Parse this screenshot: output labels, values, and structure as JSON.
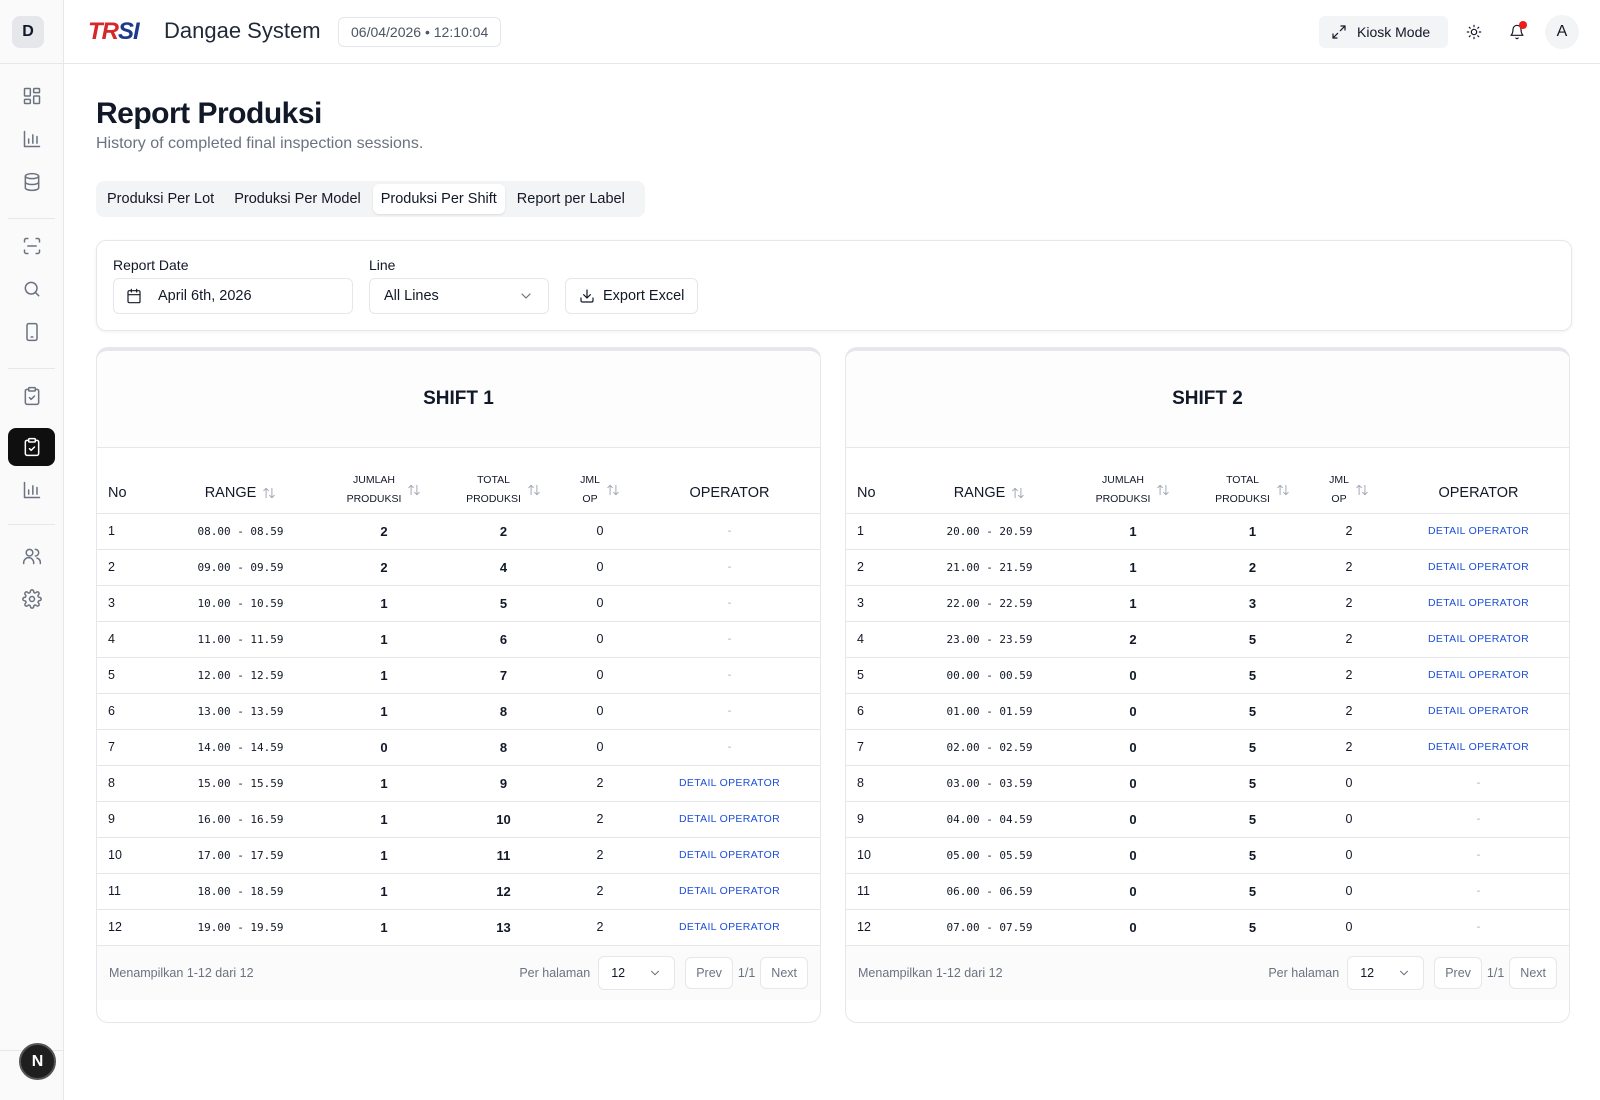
{
  "app": {
    "sidebar_initial": "D",
    "logo_part1": "TR",
    "logo_part2": "SI",
    "title": "Dangae System",
    "datetime": "06/04/2026 • 12:10:04",
    "kiosk_label": "Kiosk Mode",
    "avatar_initial": "A",
    "next_badge": "N",
    "colors": {
      "accent_active": "#0f0f0f",
      "link": "#1d4ed8",
      "notification": "#ef1c1c"
    }
  },
  "sidebar": {
    "icons": [
      "dashboard-icon",
      "bar-chart-icon",
      "database-icon",
      "scan-icon",
      "search-icon",
      "tablet-icon",
      "clipboard-check-icon",
      "clipboard-check-icon",
      "bar-chart-icon",
      "users-icon",
      "settings-icon"
    ]
  },
  "page": {
    "title": "Report Produksi",
    "subtitle": "History of completed final inspection sessions."
  },
  "tabs": [
    {
      "label": "Produksi Per Lot"
    },
    {
      "label": "Produksi Per Model"
    },
    {
      "label": "Produksi Per Shift"
    },
    {
      "label": "Report per Label"
    }
  ],
  "filters": {
    "date_label": "Report Date",
    "date_value": "April 6th, 2026",
    "line_label": "Line",
    "line_value": "All Lines",
    "export_label": "Export Excel"
  },
  "table_headers": {
    "no": "No",
    "range": "RANGE",
    "jumlah_1": "JUMLAH",
    "jumlah_2": "PRODUKSI",
    "total_1": "TOTAL",
    "total_2": "PRODUKSI",
    "jml_1": "JML",
    "jml_2": "OP",
    "operator": "OPERATOR"
  },
  "shifts": [
    {
      "title": "SHIFT 1",
      "rows": [
        {
          "no": "1",
          "range": "08.00 - 08.59",
          "jumlah": "2",
          "total": "2",
          "jml_op": "0",
          "operator": "-"
        },
        {
          "no": "2",
          "range": "09.00 - 09.59",
          "jumlah": "2",
          "total": "4",
          "jml_op": "0",
          "operator": "-"
        },
        {
          "no": "3",
          "range": "10.00 - 10.59",
          "jumlah": "1",
          "total": "5",
          "jml_op": "0",
          "operator": "-"
        },
        {
          "no": "4",
          "range": "11.00 - 11.59",
          "jumlah": "1",
          "total": "6",
          "jml_op": "0",
          "operator": "-"
        },
        {
          "no": "5",
          "range": "12.00 - 12.59",
          "jumlah": "1",
          "total": "7",
          "jml_op": "0",
          "operator": "-"
        },
        {
          "no": "6",
          "range": "13.00 - 13.59",
          "jumlah": "1",
          "total": "8",
          "jml_op": "0",
          "operator": "-"
        },
        {
          "no": "7",
          "range": "14.00 - 14.59",
          "jumlah": "0",
          "total": "8",
          "jml_op": "0",
          "operator": "-"
        },
        {
          "no": "8",
          "range": "15.00 - 15.59",
          "jumlah": "1",
          "total": "9",
          "jml_op": "2",
          "operator": "DETAIL OPERATOR"
        },
        {
          "no": "9",
          "range": "16.00 - 16.59",
          "jumlah": "1",
          "total": "10",
          "jml_op": "2",
          "operator": "DETAIL OPERATOR"
        },
        {
          "no": "10",
          "range": "17.00 - 17.59",
          "jumlah": "1",
          "total": "11",
          "jml_op": "2",
          "operator": "DETAIL OPERATOR"
        },
        {
          "no": "11",
          "range": "18.00 - 18.59",
          "jumlah": "1",
          "total": "12",
          "jml_op": "2",
          "operator": "DETAIL OPERATOR"
        },
        {
          "no": "12",
          "range": "19.00 - 19.59",
          "jumlah": "1",
          "total": "13",
          "jml_op": "2",
          "operator": "DETAIL OPERATOR"
        }
      ],
      "pager": {
        "showing": "Menampilkan 1-12 dari 12",
        "per_page_label": "Per halaman",
        "per_page": "12",
        "prev": "Prev",
        "page_info": "1/1",
        "next": "Next"
      }
    },
    {
      "title": "SHIFT 2",
      "rows": [
        {
          "no": "1",
          "range": "20.00 - 20.59",
          "jumlah": "1",
          "total": "1",
          "jml_op": "2",
          "operator": "DETAIL OPERATOR"
        },
        {
          "no": "2",
          "range": "21.00 - 21.59",
          "jumlah": "1",
          "total": "2",
          "jml_op": "2",
          "operator": "DETAIL OPERATOR"
        },
        {
          "no": "3",
          "range": "22.00 - 22.59",
          "jumlah": "1",
          "total": "3",
          "jml_op": "2",
          "operator": "DETAIL OPERATOR"
        },
        {
          "no": "4",
          "range": "23.00 - 23.59",
          "jumlah": "2",
          "total": "5",
          "jml_op": "2",
          "operator": "DETAIL OPERATOR"
        },
        {
          "no": "5",
          "range": "00.00 - 00.59",
          "jumlah": "0",
          "total": "5",
          "jml_op": "2",
          "operator": "DETAIL OPERATOR"
        },
        {
          "no": "6",
          "range": "01.00 - 01.59",
          "jumlah": "0",
          "total": "5",
          "jml_op": "2",
          "operator": "DETAIL OPERATOR"
        },
        {
          "no": "7",
          "range": "02.00 - 02.59",
          "jumlah": "0",
          "total": "5",
          "jml_op": "2",
          "operator": "DETAIL OPERATOR"
        },
        {
          "no": "8",
          "range": "03.00 - 03.59",
          "jumlah": "0",
          "total": "5",
          "jml_op": "0",
          "operator": "-"
        },
        {
          "no": "9",
          "range": "04.00 - 04.59",
          "jumlah": "0",
          "total": "5",
          "jml_op": "0",
          "operator": "-"
        },
        {
          "no": "10",
          "range": "05.00 - 05.59",
          "jumlah": "0",
          "total": "5",
          "jml_op": "0",
          "operator": "-"
        },
        {
          "no": "11",
          "range": "06.00 - 06.59",
          "jumlah": "0",
          "total": "5",
          "jml_op": "0",
          "operator": "-"
        },
        {
          "no": "12",
          "range": "07.00 - 07.59",
          "jumlah": "0",
          "total": "5",
          "jml_op": "0",
          "operator": "-"
        }
      ],
      "pager": {
        "showing": "Menampilkan 1-12 dari 12",
        "per_page_label": "Per halaman",
        "per_page": "12",
        "prev": "Prev",
        "page_info": "1/1",
        "next": "Next"
      }
    }
  ]
}
